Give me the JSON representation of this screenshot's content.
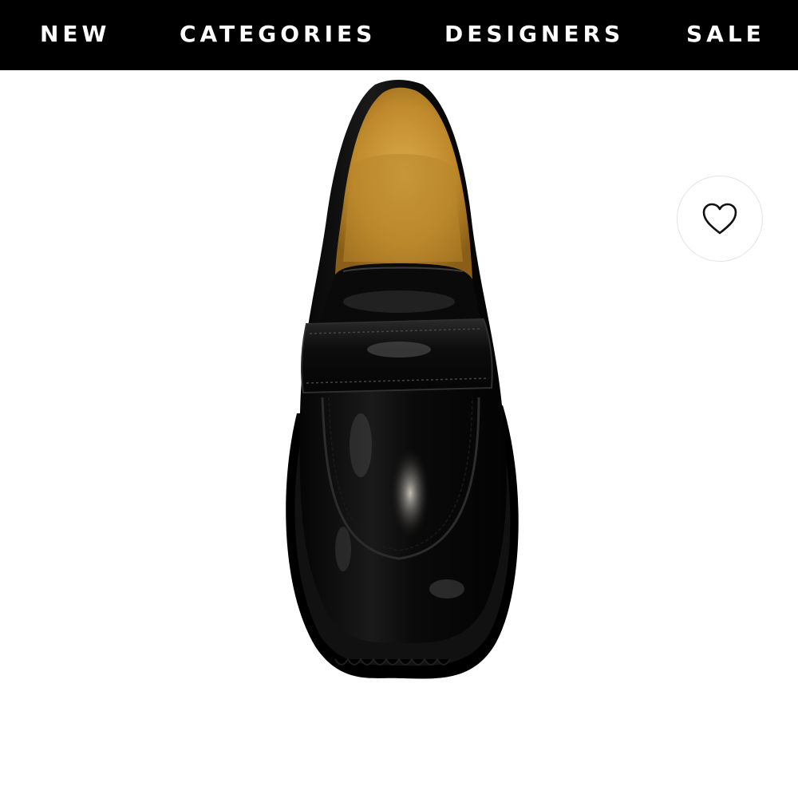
{
  "nav": {
    "items": [
      {
        "label": "NEW"
      },
      {
        "label": "CATEGORIES"
      },
      {
        "label": "DESIGNERS"
      },
      {
        "label": "SALE"
      }
    ]
  },
  "product": {
    "image": "black-patent-leather-loafer-top-view",
    "wishlist_icon": "heart-icon"
  },
  "colors": {
    "nav_background": "#000000",
    "nav_text": "#ffffff",
    "page_background": "#ffffff",
    "lining": "#c9962f"
  }
}
